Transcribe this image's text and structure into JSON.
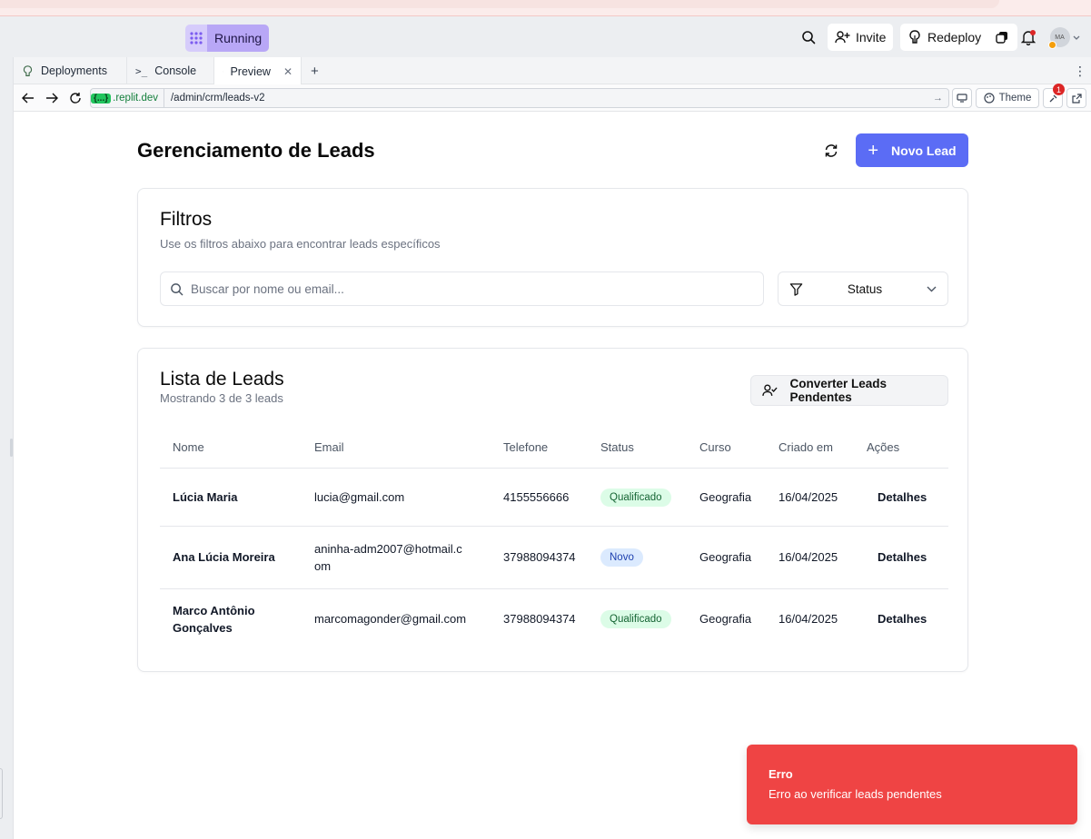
{
  "ide": {
    "run_status": "Running",
    "invite_label": "Invite",
    "redeploy_label": "Redeploy",
    "avatar_initials": "MA",
    "notification_count": "1",
    "tabs": [
      {
        "label": "Deployments",
        "icon": "deploy-icon"
      },
      {
        "label": "Console",
        "icon": "terminal-icon"
      },
      {
        "label": "Preview",
        "icon": "monitor-icon",
        "active": true
      }
    ],
    "url_badge": "{...}",
    "url_host": ".replit.dev",
    "url_path": "/admin/crm/leads-v2",
    "theme_label": "Theme"
  },
  "page": {
    "title": "Gerenciamento de Leads",
    "new_lead_label": "Novo Lead"
  },
  "filters": {
    "title": "Filtros",
    "subtitle": "Use os filtros abaixo para encontrar leads específicos",
    "search_placeholder": "Buscar por nome ou email...",
    "status_label": "Status"
  },
  "leads": {
    "title": "Lista de Leads",
    "subtitle": "Mostrando 3 de 3 leads",
    "convert_label": "Converter Leads Pendentes",
    "columns": [
      "Nome",
      "Email",
      "Telefone",
      "Status",
      "Curso",
      "Criado em",
      "Ações"
    ],
    "rows": [
      {
        "nome": "Lúcia Maria",
        "email": "lucia@gmail.com",
        "telefone": "4155556666",
        "status": "Qualificado",
        "curso": "Geografia",
        "criado": "16/04/2025",
        "acao": "Detalhes"
      },
      {
        "nome": "Ana Lúcia Moreira",
        "email": "aninha-adm2007@hotmail.com",
        "telefone": "37988094374",
        "status": "Novo",
        "curso": "Geografia",
        "criado": "16/04/2025",
        "acao": "Detalhes"
      },
      {
        "nome": "Marco Antônio Gonçalves",
        "email": "marcomagonder@gmail.com",
        "telefone": "37988094374",
        "status": "Qualificado",
        "curso": "Geografia",
        "criado": "16/04/2025",
        "acao": "Detalhes"
      }
    ]
  },
  "toast": {
    "title": "Erro",
    "message": "Erro ao verificar leads pendentes"
  },
  "colors": {
    "primary": "#5b6cf5",
    "toast_error": "#ef4444",
    "status_qualificado": "#dcfce7",
    "status_novo": "#dbeafe",
    "running": "#b8a7f6"
  }
}
